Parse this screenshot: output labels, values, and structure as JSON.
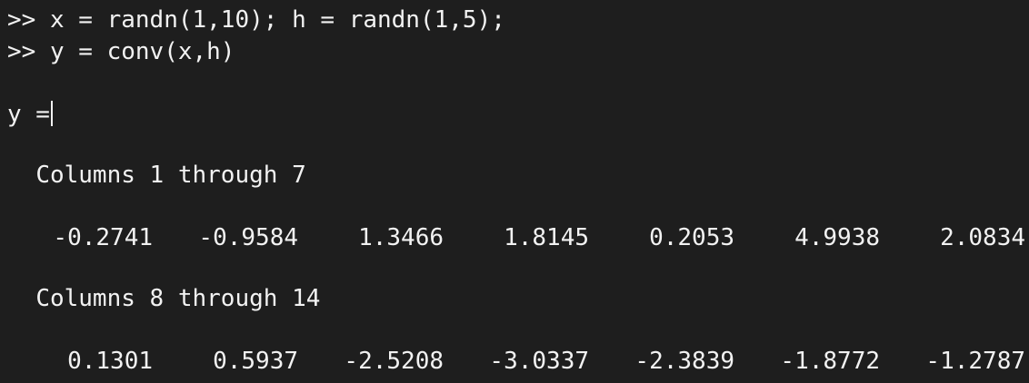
{
  "console": {
    "prompt": ">>",
    "commands": [
      "x = randn(1,10); h = randn(1,5);",
      "y = conv(x,h)"
    ],
    "output_var": "y =",
    "blocks": [
      {
        "header": "Columns 1 through 7",
        "values": [
          "-0.2741",
          "-0.9584",
          "1.3466",
          "1.8145",
          "0.2053",
          "4.9938",
          "2.0834"
        ]
      },
      {
        "header": "Columns 8 through 14",
        "values": [
          "0.1301",
          "0.5937",
          "-2.5208",
          "-3.0337",
          "-2.3839",
          "-1.8772",
          "-1.2787"
        ]
      }
    ]
  }
}
